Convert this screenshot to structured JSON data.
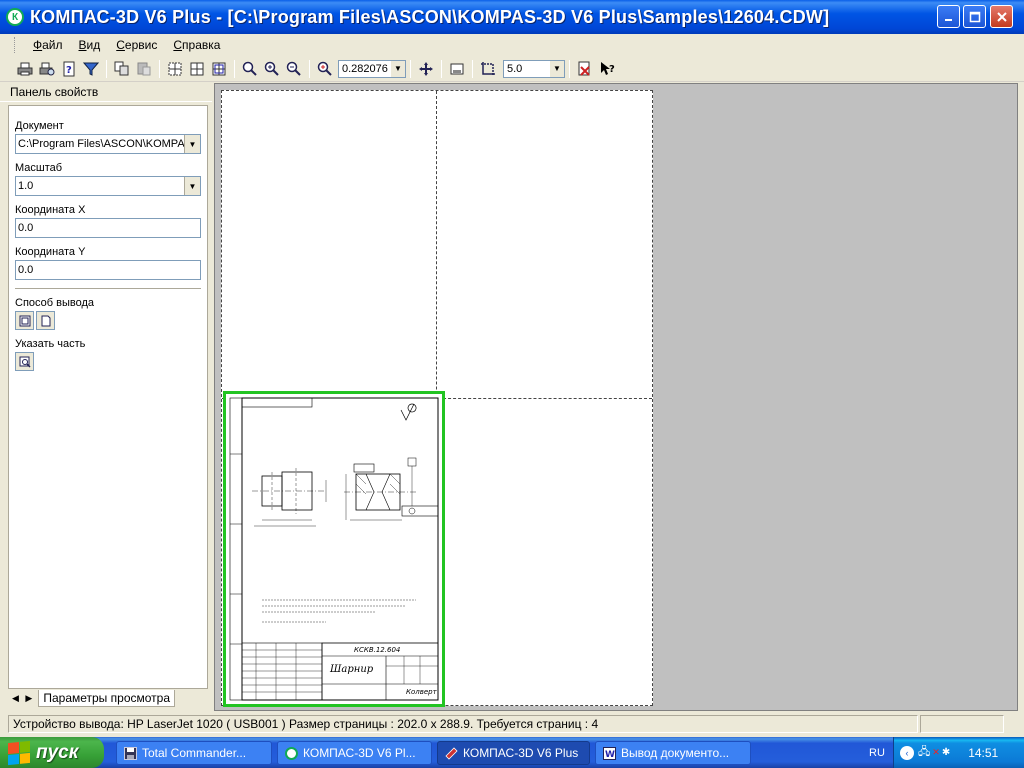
{
  "window": {
    "title": "КОМПАС-3D V6 Plus - [C:\\Program Files\\ASCON\\KOMPAS-3D V6 Plus\\Samples\\12604.CDW]",
    "app_icon": "kompas-logo-icon",
    "minimize_icon": "minimize-icon",
    "maximize_icon": "maximize-icon",
    "close_icon": "close-icon"
  },
  "menu": {
    "items": [
      {
        "label": "Файл"
      },
      {
        "label": "Вид"
      },
      {
        "label": "Сервис"
      },
      {
        "label": "Справка"
      }
    ]
  },
  "toolbar": {
    "zoom_value": "0.282076",
    "step_value": "5.0",
    "icons": [
      "print-icon",
      "print-preview-icon",
      "info-icon",
      "filter-icon",
      "copy-icon",
      "paste-icon",
      "sheet-layout-icon",
      "sheet-grid-icon",
      "sheet-fit-icon",
      "zoom-window-icon",
      "zoom-in-icon",
      "zoom-out-icon",
      "zoom-scale-icon",
      "pan-icon",
      "frame-icon",
      "snap-icon",
      "exit-preview-icon",
      "context-help-icon"
    ]
  },
  "panel": {
    "header": "Панель свойств",
    "document_label": "Документ",
    "document_value": "C:\\Program Files\\ASCON\\KOMPA",
    "scale_label": "Масштаб",
    "scale_value": "1.0",
    "x_label": "Координата X",
    "x_value": "0.0",
    "y_label": "Координата Y",
    "y_value": "0.0",
    "output_label": "Способ вывода",
    "part_label": "Указать часть",
    "tab_label": "Параметры просмотра"
  },
  "drawing": {
    "stamp_code": "КСКВ.12.604",
    "part_name": "Шарнир",
    "company": "Колверт"
  },
  "status": {
    "text": "Устройство вывода: HP LaserJet 1020  ( USB001 )  Размер страницы : 202.0 x 288.9.  Требуется страниц : 4"
  },
  "taskbar": {
    "start_label": "пуск",
    "tasks": [
      {
        "label": "Total Commander..."
      },
      {
        "label": "КОМПАС-3D V6 Pl..."
      },
      {
        "label": "КОМПАС-3D V6 Plus"
      },
      {
        "label": "Вывод документо..."
      }
    ],
    "language": "RU",
    "clock": "14:51"
  },
  "colors": {
    "title_bar": "#0055E5",
    "canvas_bg": "#C0C0C0",
    "drawing_border": "#22C422",
    "start_button": "#37A137",
    "taskbar": "#245EDB"
  }
}
